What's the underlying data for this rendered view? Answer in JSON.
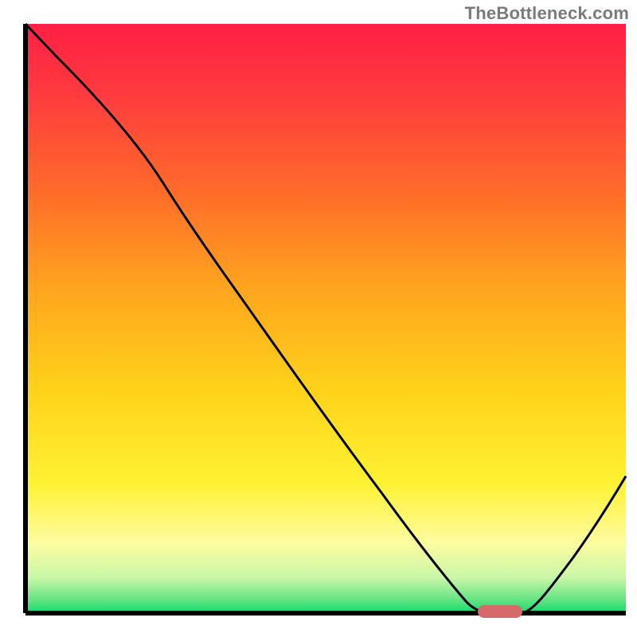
{
  "watermark": {
    "text": "TheBottleneck.com"
  },
  "colors": {
    "axis": "#000000",
    "curve": "#000000",
    "marker": "#d46a6a",
    "gradient_stops": [
      {
        "offset": 0.0,
        "color": "#ff1f44"
      },
      {
        "offset": 0.12,
        "color": "#ff3b3f"
      },
      {
        "offset": 0.28,
        "color": "#ff6a2a"
      },
      {
        "offset": 0.45,
        "color": "#ffa51e"
      },
      {
        "offset": 0.62,
        "color": "#ffd21a"
      },
      {
        "offset": 0.78,
        "color": "#fff233"
      },
      {
        "offset": 0.88,
        "color": "#fdfca0"
      },
      {
        "offset": 0.94,
        "color": "#c9f7a8"
      },
      {
        "offset": 0.975,
        "color": "#6be585"
      },
      {
        "offset": 1.0,
        "color": "#12d96d"
      }
    ]
  },
  "chart_data": {
    "type": "line",
    "title": "",
    "xlabel": "",
    "ylabel": "",
    "xlim": [
      0,
      100
    ],
    "ylim": [
      0,
      100
    ],
    "note": "Axes are unlabeled in the source image; x and y are normalized 0–100. Curve values are read from the plotted black line (high = top of plot, 0 = bottom). Marker sits at the curve minimum.",
    "series": [
      {
        "name": "bottleneck-curve",
        "x": [
          0,
          6,
          12,
          18,
          23,
          30,
          38,
          46,
          54,
          60,
          64,
          68,
          72,
          76,
          80,
          86,
          92,
          98,
          100
        ],
        "y": [
          100,
          95,
          90,
          84,
          77,
          68,
          58,
          47,
          36,
          27,
          20,
          13,
          7,
          2,
          0,
          5,
          13,
          22,
          25
        ]
      }
    ],
    "marker": {
      "x": 76,
      "y": 0,
      "width_frac": 0.06
    }
  }
}
